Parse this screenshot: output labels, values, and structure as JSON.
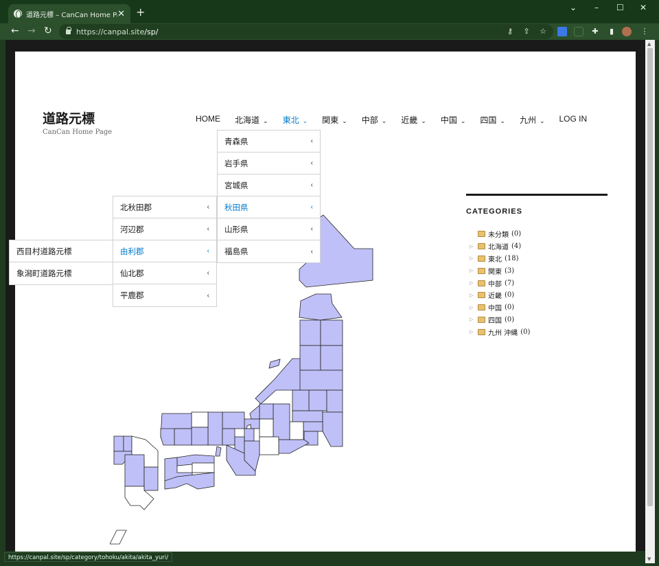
{
  "browser": {
    "tab_title": "道路元標 – CanCan Home Page",
    "tab_close": "✕",
    "new_tab": "+",
    "url_host": "https://canpal.site",
    "url_path": "/sp/",
    "status_url": "https://canpal.site/sp/category/tohoku/akita/akita_yuri/"
  },
  "site": {
    "title": "道路元標",
    "tagline": "CanCan Home Page"
  },
  "nav": [
    {
      "label": "HOME",
      "has_sub": false
    },
    {
      "label": "北海道",
      "has_sub": true
    },
    {
      "label": "東北",
      "has_sub": true,
      "active": true
    },
    {
      "label": "関東",
      "has_sub": true
    },
    {
      "label": "中部",
      "has_sub": true
    },
    {
      "label": "近畿",
      "has_sub": true
    },
    {
      "label": "中国",
      "has_sub": true
    },
    {
      "label": "四国",
      "has_sub": true
    },
    {
      "label": "九州",
      "has_sub": true
    },
    {
      "label": "LOG IN",
      "has_sub": false
    }
  ],
  "submenu_prefectures": [
    "青森県",
    "岩手県",
    "宮城県",
    "秋田県",
    "山形県",
    "福島県"
  ],
  "submenu_districts": [
    "北秋田郡",
    "河辺郡",
    "由利郡",
    "仙北郡",
    "平鹿郡"
  ],
  "submenu_villages": [
    "西目村道路元標",
    "象潟町道路元標"
  ],
  "sidebar": {
    "heading": "CATEGORIES",
    "categories": [
      {
        "name": "未分類",
        "count": "(0)",
        "expandable": false
      },
      {
        "name": "北海道",
        "count": "(4)",
        "expandable": true
      },
      {
        "name": "東北",
        "count": "(18)",
        "expandable": true
      },
      {
        "name": "関東",
        "count": "(3)",
        "expandable": true
      },
      {
        "name": "中部",
        "count": "(7)",
        "expandable": true
      },
      {
        "name": "近畿",
        "count": "(0)",
        "expandable": true
      },
      {
        "name": "中国",
        "count": "(0)",
        "expandable": true
      },
      {
        "name": "四国",
        "count": "(0)",
        "expandable": true
      },
      {
        "name": "九州 沖縄",
        "count": "(0)",
        "expandable": true
      }
    ]
  },
  "colors": {
    "accent": "#007acc",
    "map_fill": "#c0c0f8",
    "map_empty": "#ffffff",
    "chrome": "#2c4f2c"
  }
}
